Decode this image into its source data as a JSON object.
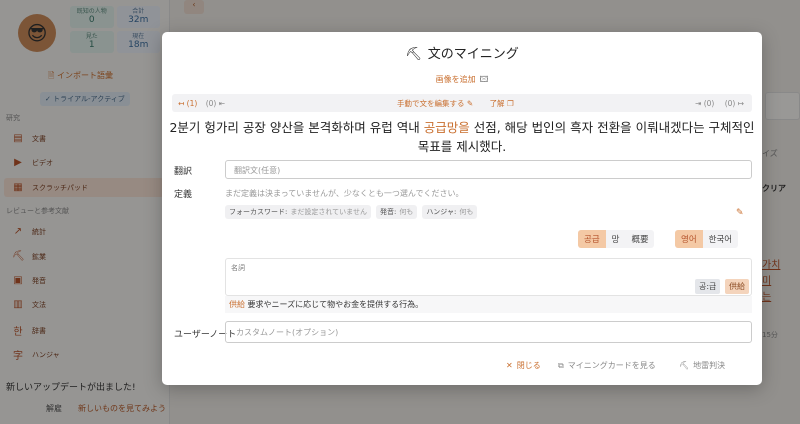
{
  "sidebar": {
    "stats": [
      {
        "label": "既知の人物",
        "value": "0"
      },
      {
        "label": "合計",
        "value": "32m"
      },
      {
        "label": "見た",
        "value": "1"
      },
      {
        "label": "現在",
        "value": "18m"
      }
    ],
    "import_link": "インポート語彙",
    "trial_badge": "トライアル-アクティブ",
    "section_study": "研究",
    "study_items": [
      "文書",
      "ビデオ",
      "スクラッチパッド"
    ],
    "section_review": "レビューと参考文献",
    "review_items": [
      "統計",
      "鉱業",
      "発音",
      "文法",
      "辞書",
      "ハンジャ"
    ],
    "update_banner": "新しいアップデートが出ました!",
    "update_dismiss": "解雇",
    "update_see": "新しいものを見てみよう"
  },
  "background": {
    "right_1": "イズ",
    "right_2": "クリア",
    "right_3_line1": "가치",
    "right_3_line2": "미",
    "right_3_line3": "는",
    "right_4": "15分"
  },
  "modal": {
    "title": "文のマイニング",
    "add_image": "画像を追加",
    "nav": {
      "prev": "(1)",
      "prev_start": "(0)",
      "edit_sentence": "手動で文を編集する",
      "understood": "了解",
      "next_end": "(0)",
      "next": "(0)"
    },
    "sentence_before": "2분기 헝가리 공장 양산을 본격화하며 유럽 역내 ",
    "sentence_highlight": "공급망을",
    "sentence_after": " 선점, 해당 법인의 흑자 전환을 이뤄내겠다는 구체적인 목표를 제시했다.",
    "translation_label": "翻訳",
    "translation_placeholder": "翻訳文(任意)",
    "definition_label": "定義",
    "definition_note": "まだ定義は決まっていませんが、少なくとも一つ選んでください。",
    "tags": [
      {
        "key": "フォーカスワード:",
        "value": "まだ設定されていません"
      },
      {
        "key": "発音:",
        "value": "何も"
      },
      {
        "key": "ハンジャ:",
        "value": "何も"
      }
    ],
    "word_forms": [
      "공급",
      "망",
      "概要"
    ],
    "languages": [
      "영어",
      "한국어"
    ],
    "noun_label": "名詞",
    "chip_korean": "공:급",
    "chip_japanese": "供給",
    "def_term": "供給",
    "def_text": " 要求やニーズに応じて物やお金を提供する行為。",
    "note_label": "ユーザーノート",
    "note_placeholder": "カスタムノート(オプション)",
    "close": "閉じる",
    "view_card": "マイニングカードを見る",
    "mine_decision": "地雷判決"
  }
}
